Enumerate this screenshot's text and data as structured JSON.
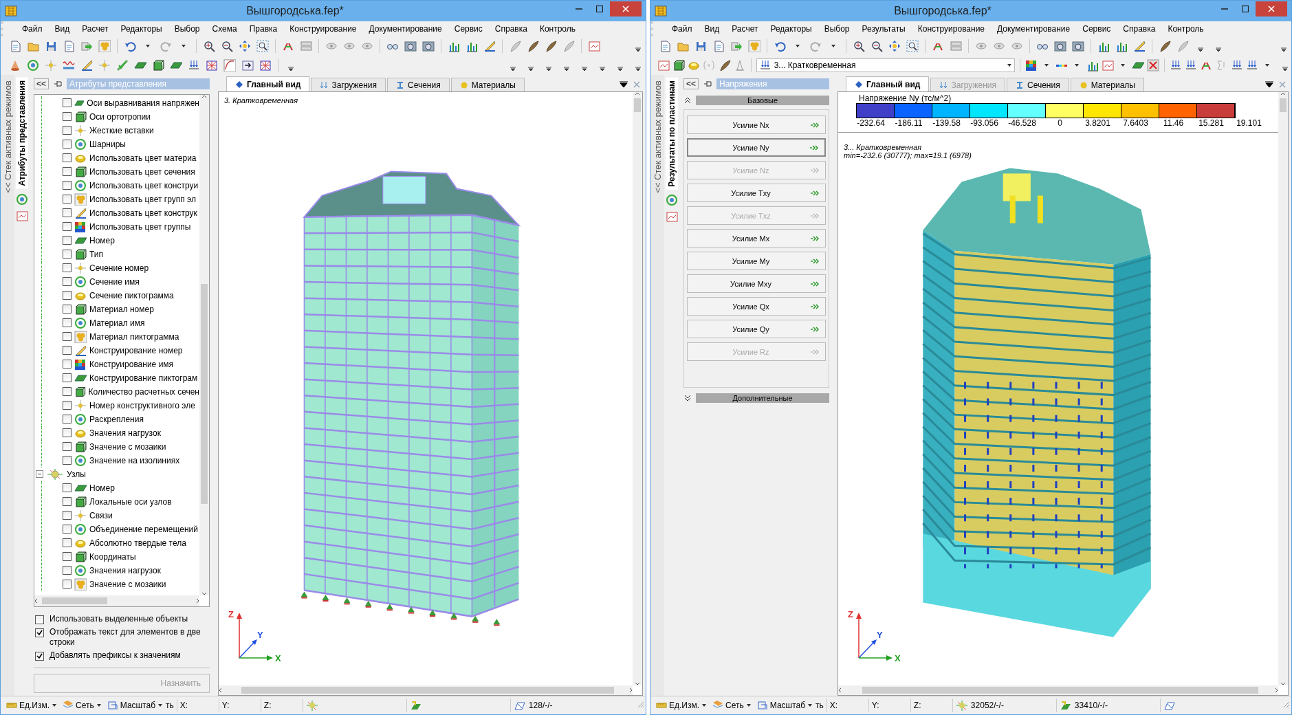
{
  "windows": [
    {
      "title": "Вышгородська.fep*",
      "menu": [
        "Файл",
        "Вид",
        "Расчет",
        "Редакторы",
        "Выбор",
        "Схема",
        "Правка",
        "Конструирование",
        "Документирование",
        "Сервис",
        "Справка",
        "Контроль"
      ],
      "mode_strip": {
        "label": "<< Стек активных режимов"
      },
      "side_tab": {
        "label": "Атрибуты представления"
      },
      "panel": {
        "kind": "attributes",
        "collapse_label": "<<",
        "header": "Атрибуты представления",
        "tree": [
          {
            "label": "Оси выравнивания напряжен",
            "checked": false
          },
          {
            "label": "Оси ортотропии",
            "checked": false
          },
          {
            "label": "Жесткие вставки",
            "checked": false
          },
          {
            "label": "Шарниры",
            "checked": false
          },
          {
            "label": "Использовать цвет материа",
            "checked": false
          },
          {
            "label": "Использовать цвет сечения",
            "checked": false
          },
          {
            "label": "Использовать цвет конструи",
            "checked": false
          },
          {
            "label": "Использовать цвет групп эл",
            "checked": false
          },
          {
            "label": "Использовать цвет конструк",
            "checked": false
          },
          {
            "label": "Использовать цвет группы",
            "checked": false
          },
          {
            "label": "Номер",
            "checked": false
          },
          {
            "label": "Тип",
            "checked": false
          },
          {
            "label": "Сечение номер",
            "checked": false
          },
          {
            "label": "Сечение имя",
            "checked": false
          },
          {
            "label": "Сечение пиктограмма",
            "checked": false
          },
          {
            "label": "Материал номер",
            "checked": false
          },
          {
            "label": "Материал имя",
            "checked": false
          },
          {
            "label": "Материал пиктограмма",
            "checked": false
          },
          {
            "label": "Конструирование номер",
            "checked": false
          },
          {
            "label": "Конструирование имя",
            "checked": false
          },
          {
            "label": "Конструирование пиктограм",
            "checked": false
          },
          {
            "label": "Количество расчетных сечен",
            "checked": false
          },
          {
            "label": "Номер конструктивного эле",
            "checked": false
          },
          {
            "label": "Раскрепления",
            "checked": false
          },
          {
            "label": "Значения нагрузок",
            "checked": false
          },
          {
            "label": "Значение с мозаики",
            "checked": false
          },
          {
            "label": "Значение на изолиниях",
            "checked": false
          },
          {
            "label": "Узлы",
            "expanded": true,
            "children": [
              {
                "label": "Номер",
                "checked": false
              },
              {
                "label": "Локальные оси узлов",
                "checked": false
              },
              {
                "label": "Связи",
                "checked": false
              },
              {
                "label": "Объединение перемещений",
                "checked": false
              },
              {
                "label": "Абсолютно твердые тела",
                "checked": false
              },
              {
                "label": "Координаты",
                "checked": false
              },
              {
                "label": "Значения нагрузок",
                "checked": false
              },
              {
                "label": "Значение с мозаики",
                "checked": false
              }
            ]
          }
        ],
        "options": [
          {
            "label": "Использовать выделенные объекты",
            "checked": false
          },
          {
            "label": "Отображать текст для элементов в две строки",
            "checked": true
          },
          {
            "label": "Добавлять префиксы к значениям",
            "checked": true
          }
        ],
        "apply_button": {
          "label": "Назначить",
          "disabled": true
        }
      },
      "view_tabs": [
        {
          "label": "Главный вид",
          "selected": true,
          "disabled": false
        },
        {
          "label": "Загружения",
          "selected": false,
          "disabled": false
        },
        {
          "label": "Сечения",
          "selected": false,
          "disabled": false
        },
        {
          "label": "Материалы",
          "selected": false,
          "disabled": false
        }
      ],
      "view": {
        "kind": "model",
        "captions": [
          "3. Кратковременная"
        ],
        "axes": [
          "Z",
          "Y",
          "X"
        ]
      },
      "status_bar": {
        "menus": [
          "Ед.Изм.",
          "Сеть",
          "Масштаб"
        ],
        "fragment": "ть",
        "coords": [
          "X:",
          "Y:",
          "Z:"
        ],
        "counters": [
          {
            "kind": "node"
          },
          {
            "kind": "element"
          },
          {
            "kind": "plate",
            "text": "128/-/-"
          }
        ]
      }
    },
    {
      "title": "Вышгородська.fep*",
      "menu": [
        "Файл",
        "Вид",
        "Расчет",
        "Редакторы",
        "Выбор",
        "Результаты",
        "Конструирование",
        "Документирование",
        "Сервис",
        "Справка",
        "Контроль"
      ],
      "toolbar_dropdown": {
        "value": "3... Кратковременная"
      },
      "mode_strip": {
        "label": "<< Стек активных режимов"
      },
      "side_tab": {
        "label": "Результаты по пластинам"
      },
      "panel": {
        "kind": "results",
        "collapse_label": "<<",
        "header": "Напряжения",
        "sections": [
          {
            "label": "Базовые",
            "expanded": true,
            "buttons": [
              {
                "label": "Усилие Nx",
                "selected": false,
                "disabled": false
              },
              {
                "label": "Усилие Ny",
                "selected": true,
                "disabled": false
              },
              {
                "label": "Усилие Nz",
                "selected": false,
                "disabled": true
              },
              {
                "label": "Усилие Txy",
                "selected": false,
                "disabled": false
              },
              {
                "label": "Усилие Txz",
                "selected": false,
                "disabled": true
              },
              {
                "label": "Усилие Mx",
                "selected": false,
                "disabled": false
              },
              {
                "label": "Усилие My",
                "selected": false,
                "disabled": false
              },
              {
                "label": "Усилие Mxy",
                "selected": false,
                "disabled": false
              },
              {
                "label": "Усилие Qx",
                "selected": false,
                "disabled": false
              },
              {
                "label": "Усилие Qy",
                "selected": false,
                "disabled": false
              },
              {
                "label": "Усилие Rz",
                "selected": false,
                "disabled": true
              }
            ]
          },
          {
            "label": "Дополнительные",
            "expanded": false
          }
        ]
      },
      "view_tabs": [
        {
          "label": "Главный вид",
          "selected": true,
          "disabled": false
        },
        {
          "label": "Загружения",
          "selected": false,
          "disabled": true
        },
        {
          "label": "Сечения",
          "selected": false,
          "disabled": false
        },
        {
          "label": "Материалы",
          "selected": false,
          "disabled": false
        }
      ],
      "view": {
        "kind": "results",
        "legend": {
          "title": "Напряжение Ny (тс/м^2)",
          "cells": [
            {
              "color": "#3f3fc8"
            },
            {
              "color": "#0a64ff"
            },
            {
              "color": "#00b4ff"
            },
            {
              "color": "#00e6ff"
            },
            {
              "color": "#64ffff"
            },
            {
              "color": "#ffff64"
            },
            {
              "color": "#ffe600"
            },
            {
              "color": "#ffc000"
            },
            {
              "color": "#ff6400"
            },
            {
              "color": "#c83c3c"
            }
          ],
          "ticks": [
            "-232.64",
            "-186.11",
            "-139.58",
            "-93.056",
            "-46.528",
            "0",
            "3.8201",
            "7.6403",
            "11.46",
            "15.281",
            "19.101"
          ]
        },
        "captions": [
          "3... Кратковременная",
          "min=-232.6 (30777); max=19.1 (6978)"
        ],
        "axes": [
          "Z",
          "Y",
          "X"
        ]
      },
      "status_bar": {
        "menus": [
          "Ед.Изм.",
          "Сеть",
          "Масштаб"
        ],
        "fragment": "ть",
        "coords": [
          "X:",
          "Y:",
          "Z:"
        ],
        "counters": [
          {
            "kind": "node",
            "text": "32052/-/-"
          },
          {
            "kind": "element",
            "text": "33410/-/-"
          },
          {
            "kind": "plate"
          }
        ]
      }
    }
  ]
}
